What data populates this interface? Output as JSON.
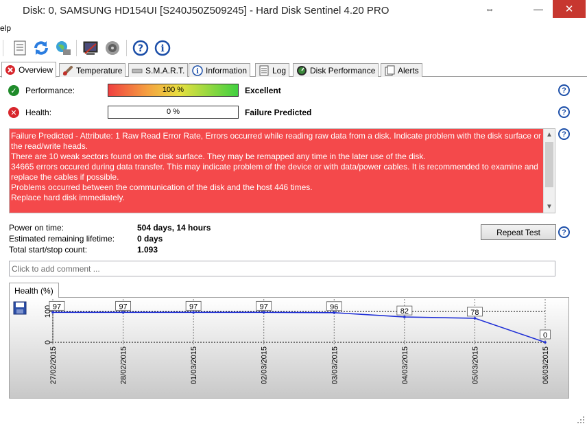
{
  "window": {
    "title": "Disk: 0, SAMSUNG HD154UI [S240J50Z509245]  -  Hard Disk Sentinel 4.20 PRO",
    "restore_glyph": "⇔",
    "minimize_glyph": "—",
    "close_glyph": "✕"
  },
  "menu": {
    "items": [
      "elp"
    ]
  },
  "toolbar": {
    "icons": [
      "report-icon",
      "refresh-icon",
      "network-icon",
      "settings-icon",
      "speaker-icon",
      "help-icon",
      "info-icon"
    ]
  },
  "tabs": [
    {
      "label": "Overview",
      "icon": "error-icon",
      "active": true
    },
    {
      "label": "Temperature",
      "icon": "thermometer-icon",
      "active": false
    },
    {
      "label": "S.M.A.R.T.",
      "icon": "smart-icon",
      "active": false
    },
    {
      "label": "Information",
      "icon": "info-icon",
      "active": false
    },
    {
      "label": "Log",
      "icon": "log-icon",
      "active": false
    },
    {
      "label": "Disk Performance",
      "icon": "gauge-icon",
      "active": false
    },
    {
      "label": "Alerts",
      "icon": "alerts-icon",
      "active": false
    }
  ],
  "overview": {
    "performance": {
      "label": "Performance:",
      "bar_text": "100 %",
      "percent": 100,
      "value": "Excellent"
    },
    "health": {
      "label": "Health:",
      "bar_text": "0 %",
      "percent": 0,
      "value": "Failure Predicted"
    },
    "alert_lines": [
      "Failure Predicted - Attribute: 1 Raw Read Error Rate, Errors occurred while reading raw data from a disk. Indicate problem with the disk surface or the read/write heads.",
      "There are 10 weak sectors found on the disk surface. They may be remapped any time in the later use of the disk.",
      "34665 errors occured during data transfer. This may indicate problem of the device or with data/power cables. It is recommended to examine and replace the cables if possible.",
      "Problems occurred between the communication of the disk and the host 446 times.",
      "Replace hard disk immediately."
    ],
    "alert_color": "#f4494b",
    "info": [
      {
        "label": "Power on time:",
        "value": "504 days, 14 hours"
      },
      {
        "label": "Estimated remaining lifetime:",
        "value": "0 days"
      },
      {
        "label": "Total start/stop count:",
        "value": "1.093"
      }
    ],
    "repeat_button": "Repeat Test",
    "comment_placeholder": "Click to add comment ...",
    "help_glyph": "?"
  },
  "chart_tab_label": "Health (%)",
  "chart_data": {
    "type": "line",
    "x": [
      "27/02/2015",
      "28/02/2015",
      "01/03/2015",
      "02/03/2015",
      "03/03/2015",
      "04/03/2015",
      "05/03/2015",
      "06/03/2015"
    ],
    "series": [
      {
        "values": [
          97,
          97,
          97,
          97,
          96,
          82,
          78,
          0
        ]
      }
    ],
    "data_labels": [
      "97",
      "97",
      "97",
      "97",
      "96",
      "82",
      "78",
      "0"
    ],
    "y_ticks": [
      "0",
      "100"
    ],
    "ylim": [
      0,
      100
    ],
    "grid": true,
    "line_color": "#1f2fd6"
  }
}
